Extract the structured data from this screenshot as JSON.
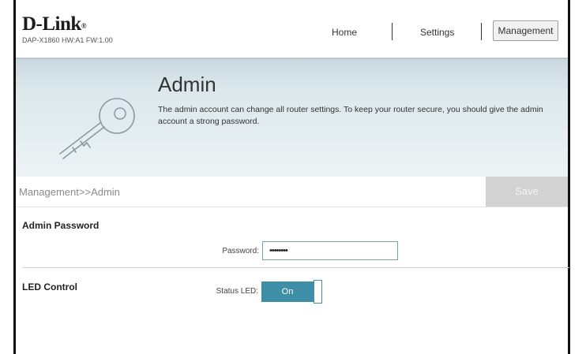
{
  "header": {
    "brand": "D-Link",
    "brand_mark": "®",
    "model_info": "DAP-X1860 HW:A1 FW:1.00",
    "nav": {
      "home": "Home",
      "settings": "Settings",
      "management": "Management"
    }
  },
  "hero": {
    "title": "Admin",
    "description": "The admin account can change all router settings. To keep your router secure, you should give the admin account a strong password.",
    "icon": "key-icon"
  },
  "breadcrumb": "Management>>Admin",
  "toolbar": {
    "save_label": "Save"
  },
  "admin_password": {
    "section_title": "Admin Password",
    "label": "Password:",
    "value": "••••••••"
  },
  "led_control": {
    "section_title": "LED Control",
    "label": "Status LED:",
    "toggle_label": "On"
  },
  "colors": {
    "accent": "#3d8ea6",
    "save_disabled": "#d2d2d2"
  }
}
